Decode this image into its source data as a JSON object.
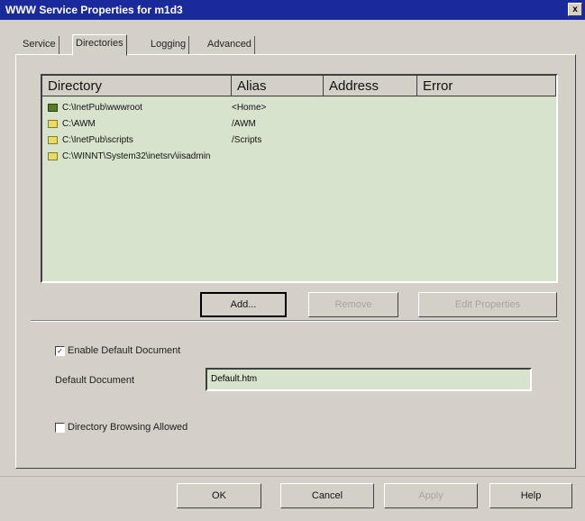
{
  "window": {
    "title": "WWW Service Properties for m1d3",
    "close_glyph": "x"
  },
  "tabs": [
    {
      "label": "Service"
    },
    {
      "label": "Directories"
    },
    {
      "label": "Logging"
    },
    {
      "label": "Advanced"
    }
  ],
  "active_tab": "Directories",
  "list": {
    "columns": [
      "Directory",
      "Alias",
      "Address",
      "Error"
    ],
    "rows": [
      {
        "directory": "C:\\InetPub\\wwwroot",
        "alias": "<Home>",
        "icon": "web-home-icon"
      },
      {
        "directory": "C:\\AWM",
        "alias": "/AWM",
        "icon": "folder-icon"
      },
      {
        "directory": "C:\\InetPub\\scripts",
        "alias": "/Scripts",
        "icon": "folder-icon"
      },
      {
        "directory": "C:\\WINNT\\System32\\inetsrv\\iisadmin",
        "alias": "",
        "icon": "folder-icon"
      }
    ]
  },
  "buttons": {
    "add": "Add...",
    "remove": "Remove",
    "edit_properties": "Edit Properties"
  },
  "options": {
    "enable_default_document": {
      "label": "Enable Default Document",
      "checked": true
    },
    "default_document_label": "Default Document",
    "default_document_value": "Default.htm",
    "directory_browsing": {
      "label": "Directory Browsing Allowed",
      "checked": false
    }
  },
  "footer": {
    "ok": "OK",
    "cancel": "Cancel",
    "apply": "Apply",
    "help": "Help"
  },
  "colors": {
    "titlebar": "#1a2a9c",
    "face": "#d4d0c8",
    "list_bg": "#d7e3cd"
  }
}
